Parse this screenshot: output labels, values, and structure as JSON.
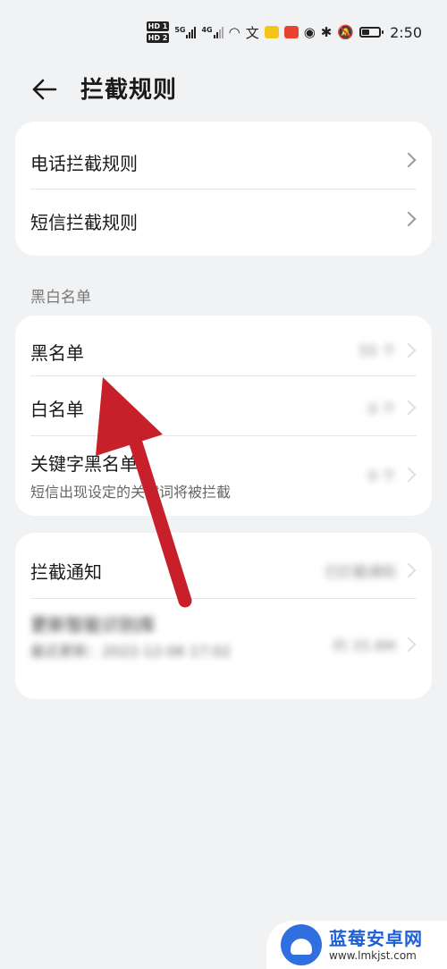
{
  "status_bar": {
    "time": "2:50",
    "net1": "5G",
    "net2": "4G",
    "battery_level": 0.45
  },
  "header": {
    "title": "拦截规则"
  },
  "rules": [
    {
      "label": "电话拦截规则"
    },
    {
      "label": "短信拦截规则"
    }
  ],
  "lists_section": {
    "title": "黑白名单",
    "items": [
      {
        "label": "黑名单",
        "value": "55 个"
      },
      {
        "label": "白名单",
        "value": "0 个"
      },
      {
        "label": "关键字黑名单",
        "sub": "短信出现设定的关键词将被拦截",
        "value": "0 个"
      }
    ]
  },
  "notify_section": {
    "items": [
      {
        "label": "拦截通知",
        "value": "已拦截通知"
      },
      {
        "label": "更新智能识别库",
        "sub": "最近更新：2022-12-06 17:02",
        "value": "约 35.8M"
      }
    ]
  },
  "watermark": {
    "name": "蓝莓安卓网",
    "url": "www.lmkjst.com"
  },
  "colors": {
    "background": "#f1f2f4",
    "card": "#ffffff",
    "annotation_arrow": "#c8202a",
    "watermark_blue": "#1e5fd6"
  }
}
